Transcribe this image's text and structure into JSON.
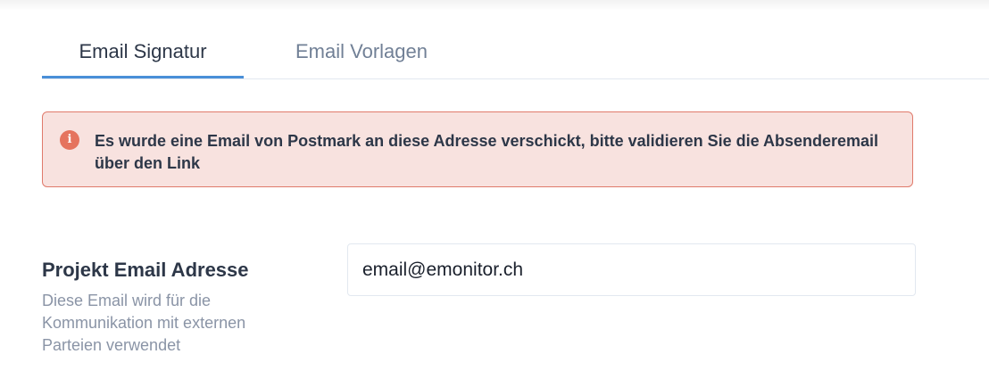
{
  "tabs": {
    "items": [
      {
        "label": "Email Signatur",
        "active": true
      },
      {
        "label": "Email Vorlagen",
        "active": false
      }
    ]
  },
  "alert": {
    "icon": "info-icon",
    "icon_glyph": "i",
    "message": "Es wurde eine Email von Postmark an diese Adresse verschickt, bitte validieren Sie die Absenderemail über den Link",
    "color_bg": "#f8e2df",
    "color_border": "#e07a6b"
  },
  "project_email": {
    "label": "Projekt Email Adresse",
    "help": "Diese Email wird für die Kommunikation mit externen Parteien verwendet",
    "value": "email@emonitor.ch"
  },
  "colors": {
    "accent": "#4a8fd8",
    "text_primary": "#2d3748",
    "text_muted": "#8a94a6"
  }
}
